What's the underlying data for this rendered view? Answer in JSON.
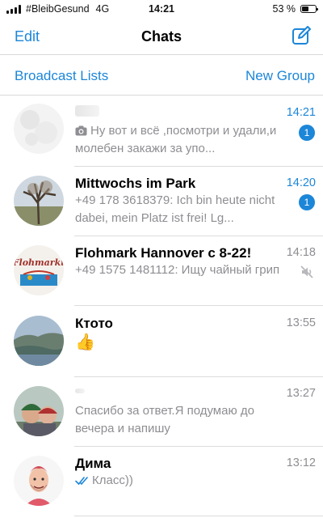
{
  "status_bar": {
    "carrier": "#BleibGesund",
    "network": "4G",
    "time": "14:21",
    "battery": "53 %",
    "battery_level": 0.53
  },
  "nav": {
    "edit": "Edit",
    "title": "Chats",
    "compose_icon": "compose-icon"
  },
  "sub_bar": {
    "broadcast": "Broadcast Lists",
    "new_group": "New Group"
  },
  "colors": {
    "accent": "#1c86d8",
    "muted": "#8e8e93"
  },
  "chats": [
    {
      "name": "",
      "time": "14:21",
      "unread": "1",
      "preview_icon": "camera-icon",
      "preview": "Ну вот и всё ,посмотри и удали,и молебен закажи за упо..."
    },
    {
      "name": "Mittwochs im Park",
      "time": "14:20",
      "unread": "1",
      "sender": "+49 178 3618379:",
      "preview": " Ich bin heute nicht dabei, mein Platz ist frei! Lg..."
    },
    {
      "name": "Flohmark Hannover c 8-22!",
      "time": "14:18",
      "muted": true,
      "sender": "+49 1575 1481112:",
      "preview": " Ищу чайный грип",
      "avatar_text": "Flohmarkt"
    },
    {
      "name": "Ктото",
      "time": "13:55",
      "preview": "👍"
    },
    {
      "name": "",
      "time": "13:27",
      "preview": "Спасибо за ответ.Я подумаю до вечера и напишу"
    },
    {
      "name": "Дима",
      "time": "13:12",
      "preview_icon": "double-check-icon",
      "preview": "Класс))"
    }
  ]
}
